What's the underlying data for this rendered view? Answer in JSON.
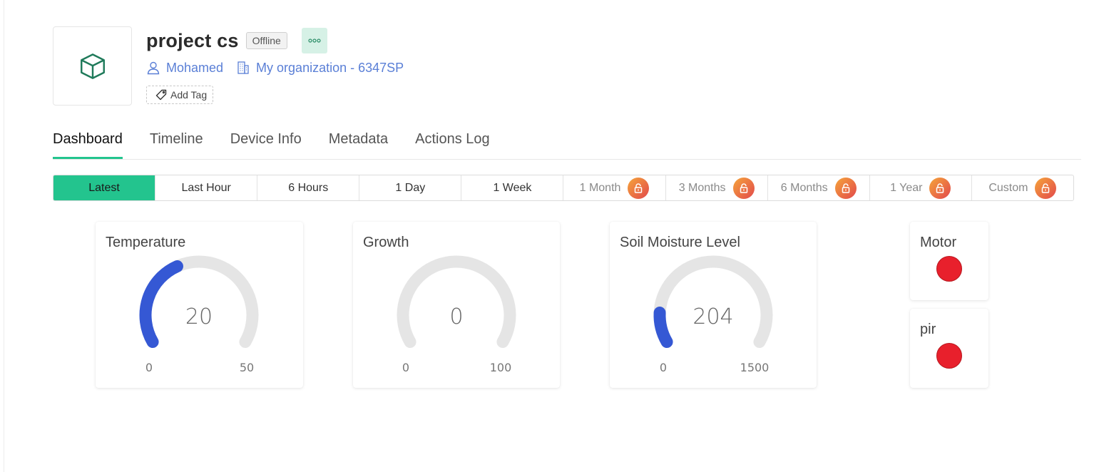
{
  "device": {
    "title": "project cs",
    "status": "Offline",
    "owner": "Mohamed",
    "organization": "My organization - 6347SP",
    "add_tag_label": "Add Tag"
  },
  "tabs": [
    {
      "label": "Dashboard",
      "active": true
    },
    {
      "label": "Timeline"
    },
    {
      "label": "Device Info"
    },
    {
      "label": "Metadata"
    },
    {
      "label": "Actions Log"
    }
  ],
  "ranges": [
    {
      "label": "Latest",
      "active": true,
      "locked": false
    },
    {
      "label": "Last Hour",
      "locked": false
    },
    {
      "label": "6 Hours",
      "locked": false
    },
    {
      "label": "1 Day",
      "locked": false
    },
    {
      "label": "1 Week",
      "locked": false
    },
    {
      "label": "1 Month",
      "locked": true
    },
    {
      "label": "3 Months",
      "locked": true
    },
    {
      "label": "6 Months",
      "locked": true
    },
    {
      "label": "1 Year",
      "locked": true
    },
    {
      "label": "Custom",
      "locked": true
    }
  ],
  "gauges": [
    {
      "title": "Temperature",
      "value": "20",
      "min": "0",
      "max": "50"
    },
    {
      "title": "Growth",
      "value": "0",
      "min": "0",
      "max": "100"
    },
    {
      "title": "Soil Moisture Level",
      "value": "204",
      "min": "0",
      "max": "1500"
    }
  ],
  "leds": [
    {
      "title": "Motor",
      "state": "off"
    },
    {
      "title": "pir",
      "state": "off"
    }
  ],
  "colors": {
    "accent": "#23c48e",
    "gauge_fill": "#3558d4",
    "gauge_track": "#e5e5e5",
    "led_off": "#e8202c",
    "link": "#5a7fd6"
  }
}
